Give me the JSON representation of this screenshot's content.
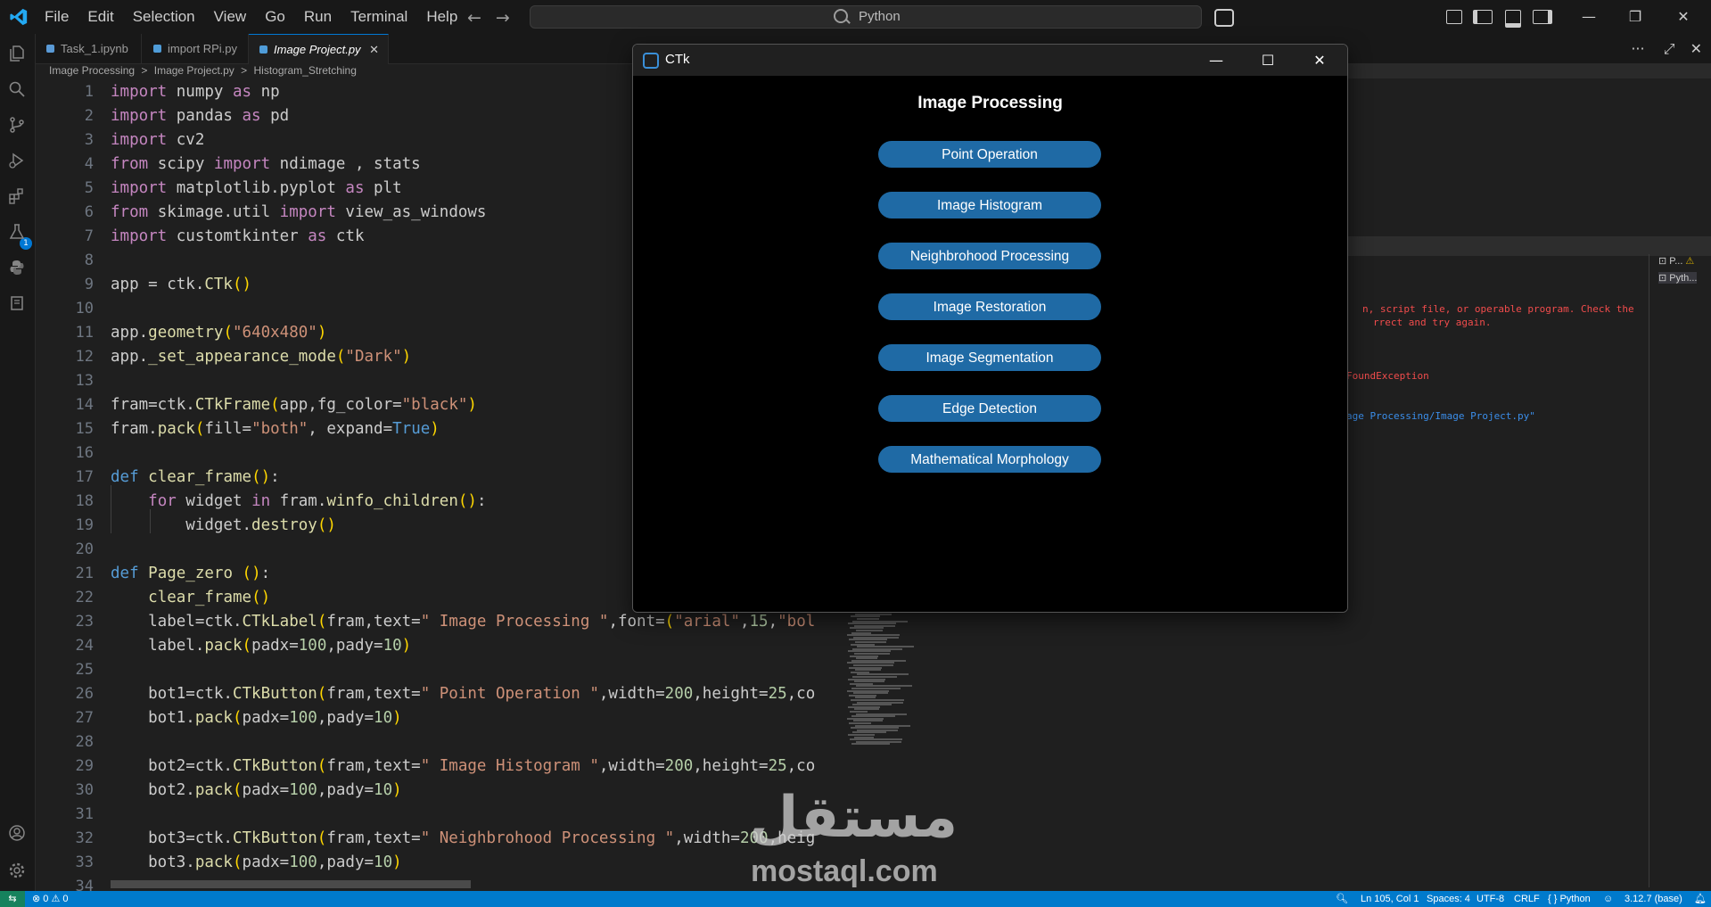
{
  "menu": [
    "File",
    "Edit",
    "Selection",
    "View",
    "Go",
    "Run",
    "Terminal",
    "Help"
  ],
  "search": {
    "text": "Python"
  },
  "tabs": [
    {
      "label": "Task_1.ipynb"
    },
    {
      "label": "import RPi.py"
    },
    {
      "label": "Image Project.py"
    }
  ],
  "tab_tools": "···",
  "breadcrumb": [
    "Image Processing",
    ">",
    "Image Project.py",
    ">",
    "Histogram_Stretching"
  ],
  "code": {
    "line_numbers": [
      "1",
      "2",
      "3",
      "4",
      "5",
      "6",
      "7",
      "8",
      "9",
      "10",
      "11",
      "12",
      "13",
      "14",
      "15",
      "16",
      "17",
      "18",
      "19",
      "20",
      "21",
      "22",
      "23",
      "24",
      "25",
      "26",
      "27",
      "28",
      "29",
      "30",
      "31",
      "32",
      "33",
      "34"
    ]
  },
  "terminal": {
    "line1": "n, script file, or operable program. Check the",
    "line2": "rrect and try again.",
    "line3": "FoundException",
    "line4": "age Processing/Image Project.py\"",
    "items": [
      "P...",
      "Pyth..."
    ]
  },
  "ctk": {
    "title": "CTk",
    "heading": "Image Processing",
    "buttons": [
      "Point Operation",
      "Image Histogram",
      "Neighbrohood Processing",
      "Image Restoration",
      "Image Segmentation",
      "Edge Detection",
      "Mathematical Morphology"
    ],
    "accent": "#1f6aa5"
  },
  "watermark": {
    "arabic": "مستقل",
    "latin": "mostaql.com"
  },
  "statusbar": {
    "problems": "⊗ 0 ⚠ 0",
    "position": "Ln 105, Col 1",
    "spaces": "Spaces: 4",
    "encoding": "UTF-8",
    "eol": "CRLF",
    "language": "{ } Python",
    "interpreter": "3.12.7 (base)"
  },
  "colors": {
    "accent": "#007acc",
    "remote": "#16825d",
    "error": "#f14c4c"
  }
}
